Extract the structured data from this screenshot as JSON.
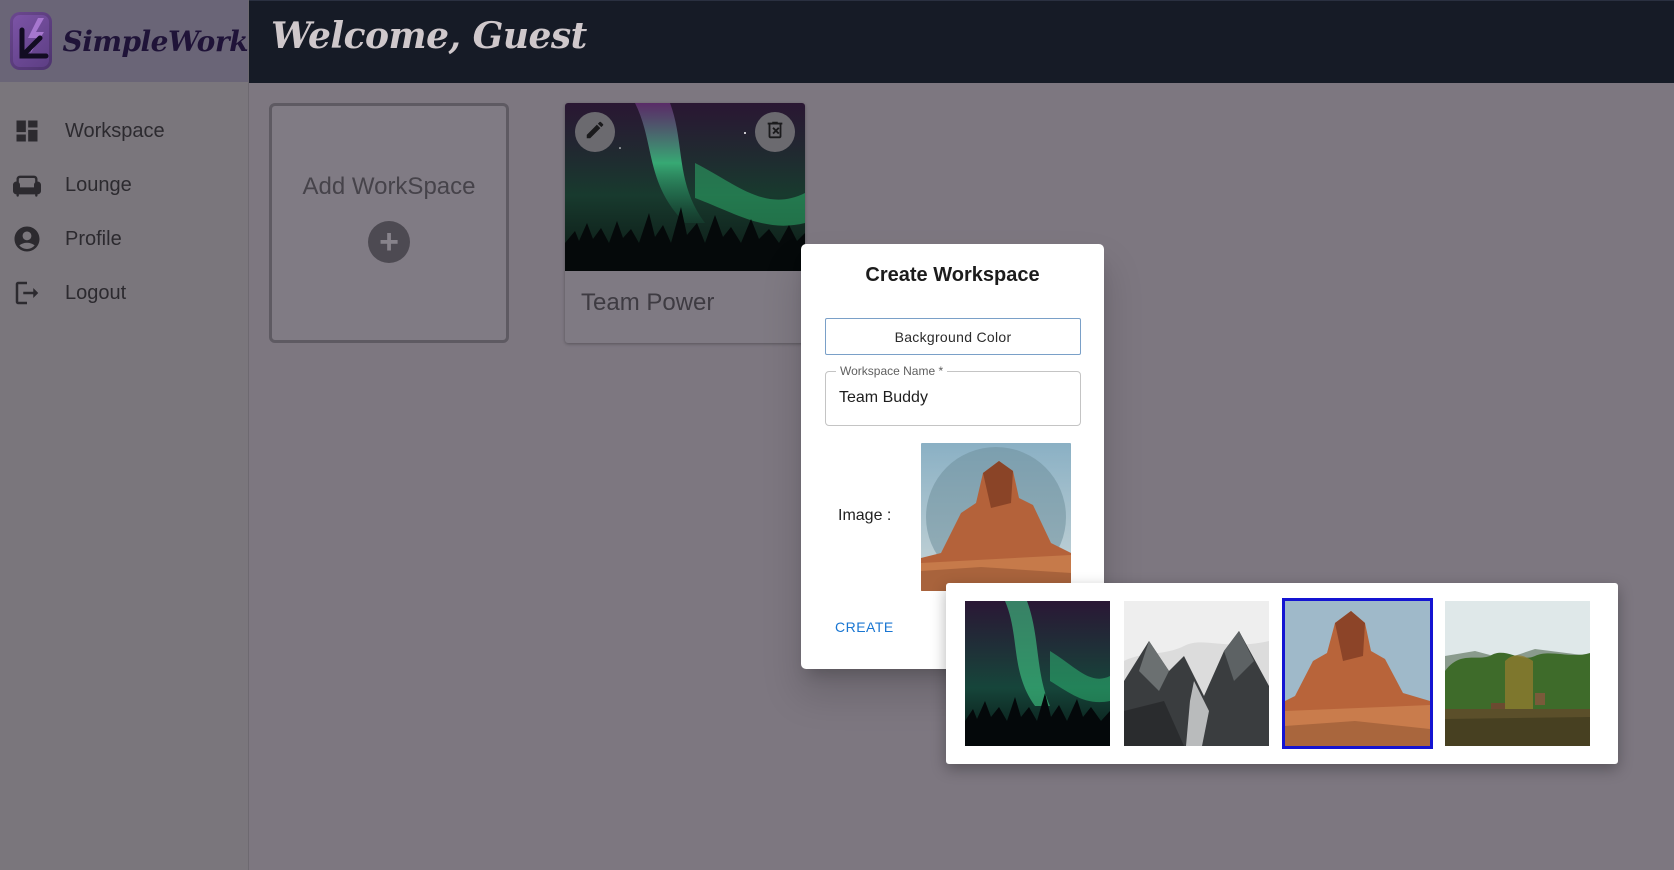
{
  "brand": {
    "name": "SimpleWork",
    "icon": "app-logo"
  },
  "header": {
    "title": "Welcome, Guest"
  },
  "sidebar": {
    "items": [
      {
        "label": "Workspace",
        "icon": "dashboard-icon"
      },
      {
        "label": "Lounge",
        "icon": "couch-icon"
      },
      {
        "label": "Profile",
        "icon": "account-circle-icon"
      },
      {
        "label": "Logout",
        "icon": "logout-icon"
      }
    ]
  },
  "main": {
    "add_card": {
      "label": "Add WorkSpace",
      "icon": "add-circle-icon"
    },
    "workspaces": [
      {
        "name": "Team Power",
        "image": "aurora",
        "edit_icon": "edit-icon",
        "delete_icon": "delete-icon"
      }
    ]
  },
  "dialog": {
    "title": "Create Workspace",
    "background_button": "Background Color",
    "name_label": "Workspace Name *",
    "name_value": "Team Buddy",
    "image_label": "Image :",
    "selected_image": "desert-rock",
    "create_label": "CREATE"
  },
  "picker": {
    "images": [
      {
        "name": "aurora",
        "selected": false
      },
      {
        "name": "misty-mountains",
        "selected": false
      },
      {
        "name": "desert-rock",
        "selected": true
      },
      {
        "name": "forest-lake",
        "selected": false
      }
    ]
  },
  "colors": {
    "header_bg": "#161b26",
    "overlay": "#7d7780",
    "accent": "#1976d2",
    "selection": "#1414d2"
  }
}
